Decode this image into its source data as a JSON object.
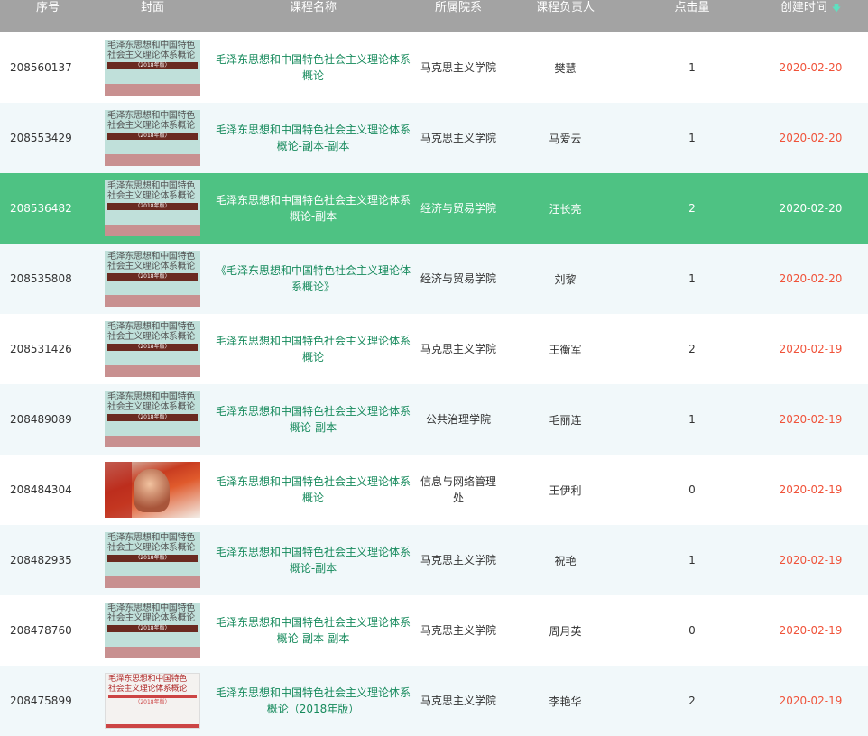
{
  "headers": {
    "id": "序号",
    "cover": "封面",
    "title": "课程名称",
    "dept": "所属院系",
    "owner": "课程负责人",
    "clicks": "点击量",
    "created": "创建时间"
  },
  "sort_icon": "arrow-down-icon",
  "colors": {
    "header_bg": "#a3a3a3",
    "title_link": "#168a5c",
    "date": "#f0533a",
    "selected_row": "#4ec283",
    "alt_row": "#f1f8fa"
  },
  "rows": [
    {
      "id": "208560137",
      "title": "毛泽东思想和中国特色社会主义理论体系概论",
      "dept": "马克思主义学院",
      "owner": "樊慧",
      "clicks": "1",
      "date": "2020-02-20",
      "cover": "book"
    },
    {
      "id": "208553429",
      "title": "毛泽东思想和中国特色社会主义理论体系概论-副本-副本",
      "dept": "马克思主义学院",
      "owner": "马爱云",
      "clicks": "1",
      "date": "2020-02-20",
      "cover": "book"
    },
    {
      "id": "208536482",
      "title": "毛泽东思想和中国特色社会主义理论体系概论-副本",
      "dept": "经济与贸易学院",
      "owner": "汪长亮",
      "clicks": "2",
      "date": "2020-02-20",
      "cover": "book",
      "selected": true
    },
    {
      "id": "208535808",
      "title": "《毛泽东思想和中国特色社会主义理论体系概论》",
      "dept": "经济与贸易学院",
      "owner": "刘黎",
      "clicks": "1",
      "date": "2020-02-20",
      "cover": "book"
    },
    {
      "id": "208531426",
      "title": "毛泽东思想和中国特色社会主义理论体系概论",
      "dept": "马克思主义学院",
      "owner": "王衡军",
      "clicks": "2",
      "date": "2020-02-19",
      "cover": "book"
    },
    {
      "id": "208489089",
      "title": "毛泽东思想和中国特色社会主义理论体系概论-副本",
      "dept": "公共治理学院",
      "owner": "毛丽连",
      "clicks": "1",
      "date": "2020-02-19",
      "cover": "book"
    },
    {
      "id": "208484304",
      "title": "毛泽东思想和中国特色社会主义理论体系概论",
      "dept": "信息与网络管理处",
      "owner": "王伊利",
      "clicks": "0",
      "date": "2020-02-19",
      "cover": "photo"
    },
    {
      "id": "208482935",
      "title": "毛泽东思想和中国特色社会主义理论体系概论-副本",
      "dept": "马克思主义学院",
      "owner": "祝艳",
      "clicks": "1",
      "date": "2020-02-19",
      "cover": "book"
    },
    {
      "id": "208478760",
      "title": "毛泽东思想和中国特色社会主义理论体系概论-副本-副本",
      "dept": "马克思主义学院",
      "owner": "周月英",
      "clicks": "0",
      "date": "2020-02-19",
      "cover": "book"
    },
    {
      "id": "208475899",
      "title": "毛泽东思想和中国特色社会主义理论体系概论（2018年版）",
      "dept": "马克思主义学院",
      "owner": "李艳华",
      "clicks": "2",
      "date": "2020-02-19",
      "cover": "white"
    }
  ],
  "cover_art": {
    "book": {
      "line1": "毛泽东思想和中国特色",
      "line2": "社会主义理论体系概论",
      "edition": "（2018年版）"
    },
    "white": {
      "line1": "毛泽东思想和中国特色",
      "line2": "社会主义理论体系概论",
      "edition": "（2018年版）"
    }
  }
}
